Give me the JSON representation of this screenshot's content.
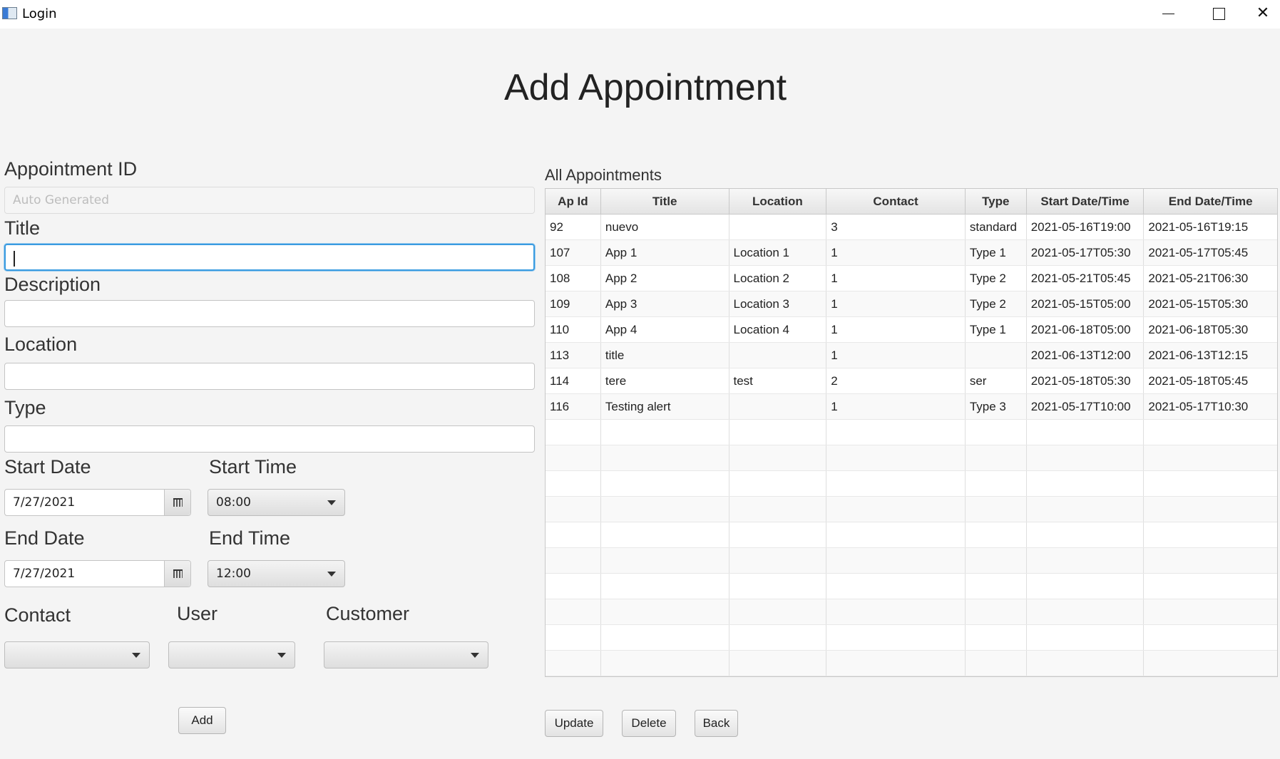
{
  "window": {
    "title": "Login"
  },
  "heading": "Add Appointment",
  "form": {
    "appointment_id_label": "Appointment ID",
    "appointment_id_placeholder": "Auto Generated",
    "title_label": "Title",
    "title_value": "",
    "description_label": "Description",
    "description_value": "",
    "location_label": "Location",
    "location_value": "",
    "type_label": "Type",
    "type_value": "",
    "start_date_label": "Start Date",
    "start_date_value": "7/27/2021",
    "start_time_label": "Start Time",
    "start_time_value": "08:00",
    "end_date_label": "End Date",
    "end_date_value": "7/27/2021",
    "end_time_label": "End Time",
    "end_time_value": "12:00",
    "contact_label": "Contact",
    "contact_value": "",
    "user_label": "User",
    "user_value": "",
    "customer_label": "Customer",
    "customer_value": "",
    "add_button": "Add"
  },
  "table": {
    "caption": "All Appointments",
    "columns": [
      "Ap Id",
      "Title",
      "Location",
      "Contact",
      "Type",
      "Start Date/Time",
      "End Date/Time"
    ],
    "rows": [
      [
        "92",
        "nuevo",
        "",
        "3",
        "standard",
        "2021-05-16T19:00",
        "2021-05-16T19:15"
      ],
      [
        "107",
        "App 1",
        "Location 1",
        "1",
        "Type 1",
        "2021-05-17T05:30",
        "2021-05-17T05:45"
      ],
      [
        "108",
        "App 2",
        "Location 2",
        "1",
        "Type 2",
        "2021-05-21T05:45",
        "2021-05-21T06:30"
      ],
      [
        "109",
        "App 3",
        "Location 3",
        "1",
        "Type 2",
        "2021-05-15T05:00",
        "2021-05-15T05:30"
      ],
      [
        "110",
        "App 4",
        "Location 4",
        "1",
        "Type 1",
        "2021-06-18T05:00",
        "2021-06-18T05:30"
      ],
      [
        "113",
        "title",
        "",
        "1",
        "",
        "2021-06-13T12:00",
        "2021-06-13T12:15"
      ],
      [
        "114",
        "tere",
        "test",
        "2",
        "ser",
        "2021-05-18T05:30",
        "2021-05-18T05:45"
      ],
      [
        "116",
        "Testing alert",
        "",
        "1",
        "Type 3",
        "2021-05-17T10:00",
        "2021-05-17T10:30"
      ]
    ]
  },
  "actions": {
    "update_button": "Update",
    "delete_button": "Delete",
    "back_button": "Back"
  }
}
